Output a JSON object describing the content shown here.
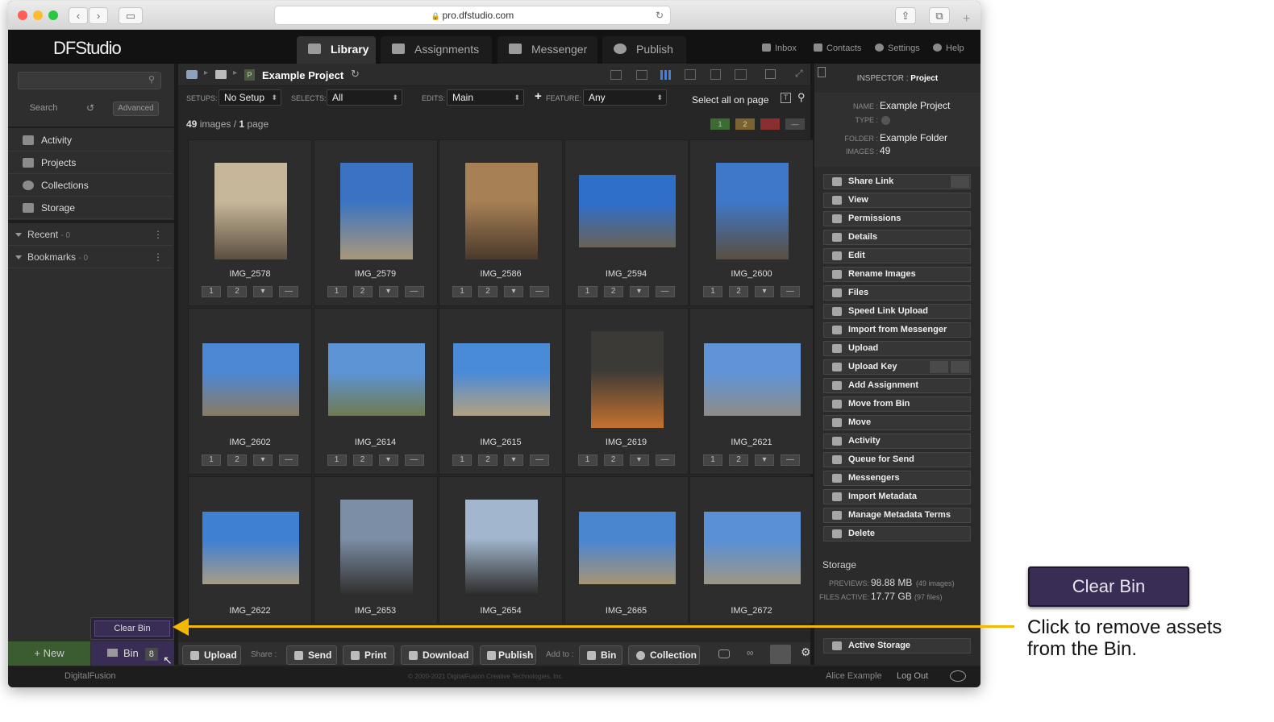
{
  "browser": {
    "url": "pro.dfstudio.com"
  },
  "app": {
    "logo": "DFStudio"
  },
  "tabs": [
    {
      "label": "Library",
      "active": true
    },
    {
      "label": "Assignments"
    },
    {
      "label": "Messenger"
    },
    {
      "label": "Publish"
    }
  ],
  "toplinks": [
    "Inbox",
    "Contacts",
    "Settings",
    "Help"
  ],
  "sidebar": {
    "search_placeholder": "",
    "search_label": "Search",
    "advanced_label": "Advanced",
    "items": [
      "Activity",
      "Projects",
      "Collections",
      "Storage"
    ],
    "recent": {
      "label": "Recent",
      "count": "- 0"
    },
    "bookmarks": {
      "label": "Bookmarks",
      "count": "- 0"
    },
    "new_label": "+ New",
    "bin_label": "Bin",
    "bin_count": "8",
    "clear_bin_popup": "Clear Bin"
  },
  "toolbar": {
    "project_badge": "P",
    "project_name": "Example Project",
    "setups_label": "SETUPS:",
    "setups_value": "No Setup",
    "selects_label": "SELECTS:",
    "selects_value": "All",
    "edits_label": "EDITS:",
    "edits_value": "Main",
    "feature_label": "FEATURE:",
    "feature_value": "Any",
    "select_all": "Select all on page",
    "count_images": "49",
    "images_word": "images /",
    "count_pages": "1",
    "page_word": "page",
    "rating_filters": [
      "1",
      "2",
      "",
      "—"
    ]
  },
  "grid": [
    {
      "name": "IMG_2578"
    },
    {
      "name": "IMG_2579"
    },
    {
      "name": "IMG_2586"
    },
    {
      "name": "IMG_2594"
    },
    {
      "name": "IMG_2600"
    },
    {
      "name": "IMG_2602"
    },
    {
      "name": "IMG_2614"
    },
    {
      "name": "IMG_2615"
    },
    {
      "name": "IMG_2619"
    },
    {
      "name": "IMG_2621"
    },
    {
      "name": "IMG_2622"
    },
    {
      "name": "IMG_2653"
    },
    {
      "name": "IMG_2654"
    },
    {
      "name": "IMG_2665"
    },
    {
      "name": "IMG_2672"
    }
  ],
  "rating_buttons": [
    "1",
    "2",
    "",
    "—"
  ],
  "bottombar": {
    "upload": "Upload",
    "share_label": "Share :",
    "send": "Send",
    "print": "Print",
    "download": "Download",
    "publish": "Publish",
    "addto_label": "Add to :",
    "bin": "Bin",
    "collection": "Collection"
  },
  "inspector": {
    "header_label": "INSPECTOR :",
    "header_value": "Project",
    "name_label": "NAME :",
    "name_value": "Example Project",
    "type_label": "TYPE :",
    "folder_label": "FOLDER :",
    "folder_value": "Example Folder",
    "images_label": "IMAGES :",
    "images_value": "49",
    "actions": [
      "Share Link",
      "View",
      "Permissions",
      "Details",
      "Edit",
      "Rename Images",
      "Files",
      "Speed Link Upload",
      "Import from Messenger",
      "Upload",
      "Upload Key",
      "Add Assignment",
      "Move from Bin",
      "Move",
      "Activity",
      "Queue for Send",
      "Messengers",
      "Import Metadata",
      "Manage Metadata Terms",
      "Delete"
    ],
    "storage_title": "Storage",
    "previews_label": "PREVIEWS:",
    "previews_value": "98.88 MB",
    "previews_note": "(49 images)",
    "files_label": "FILES ACTIVE:",
    "files_value": "17.77 GB",
    "files_note": "(97 files)",
    "active_storage": "Active Storage"
  },
  "footer": {
    "brand": "DigitalFusion",
    "copyright": "© 2000-2021 DigitalFusion Creative Technologies, Inc.",
    "user": "Alice Example",
    "logout": "Log Out"
  },
  "callout": {
    "button_label": "Clear Bin",
    "text_line1": "Click to remove assets",
    "text_line2": "from the Bin.",
    "accent_color": "#f3b800",
    "button_color": "#3a2d55"
  }
}
